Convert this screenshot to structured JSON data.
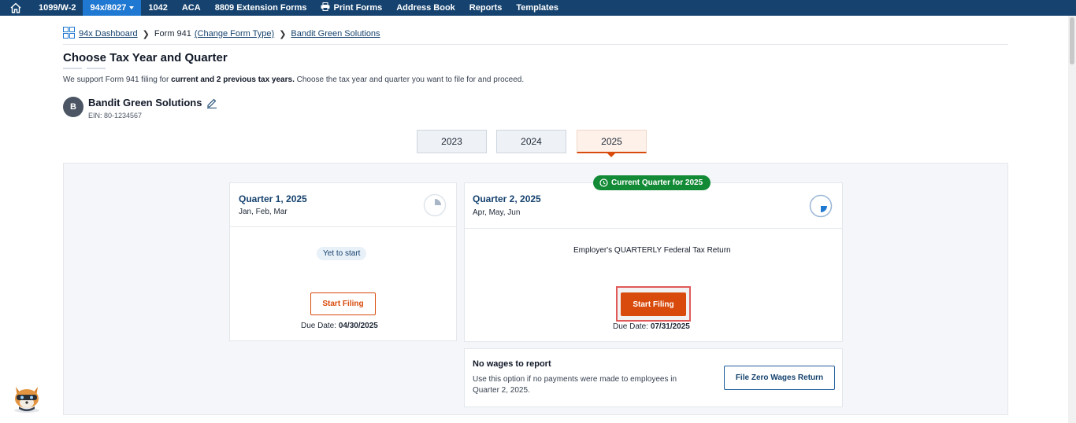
{
  "nav": {
    "items": [
      {
        "label": "1099/W-2",
        "active": false
      },
      {
        "label": "94x/8027",
        "active": true,
        "has_caret": true
      },
      {
        "label": "1042",
        "active": false
      },
      {
        "label": "ACA",
        "active": false
      },
      {
        "label": "8809 Extension Forms",
        "active": false
      },
      {
        "label": "Print Forms",
        "active": false,
        "icon": "printer-icon"
      },
      {
        "label": "Address Book",
        "active": false
      },
      {
        "label": "Reports",
        "active": false
      },
      {
        "label": "Templates",
        "active": false
      }
    ]
  },
  "breadcrumb": {
    "dashboard": "94x Dashboard",
    "form": "Form 941",
    "change_form": "(Change Form Type)",
    "business": "Bandit Green Solutions"
  },
  "page": {
    "title": "Choose Tax Year and Quarter",
    "subtitle_pre": "We support Form 941 filing for ",
    "subtitle_bold": "current and 2 previous tax years.",
    "subtitle_post": " Choose the tax year and quarter you want to file for and proceed."
  },
  "company": {
    "initial": "B",
    "name": "Bandit Green Solutions",
    "ein": "EIN: 80-1234567"
  },
  "years": [
    {
      "label": "2023",
      "active": false
    },
    {
      "label": "2024",
      "active": false
    },
    {
      "label": "2025",
      "active": true
    }
  ],
  "quarters": [
    {
      "title": "Quarter 1, 2025",
      "months": "Jan, Feb, Mar",
      "status": "Yet to start",
      "button": "Start Filing",
      "due_label": "Due Date:",
      "due_date": "04/30/2025"
    },
    {
      "title": "Quarter 2, 2025",
      "months": "Apr, May, Jun",
      "badge": "Current Quarter for 2025",
      "return_title": "Employer's QUARTERLY Federal Tax Return",
      "button": "Start Filing",
      "due_label": "Due Date:",
      "due_date": "07/31/2025"
    }
  ],
  "no_wages": {
    "title": "No wages to report",
    "description": "Use this option if no payments were made to employees in Quarter 2, 2025.",
    "button": "File Zero Wages Return"
  },
  "colors": {
    "nav_bg": "#15426e",
    "nav_active": "#1f78d1",
    "accent": "#d84b0c",
    "badge_green": "#138a36",
    "link": "#15426e"
  }
}
